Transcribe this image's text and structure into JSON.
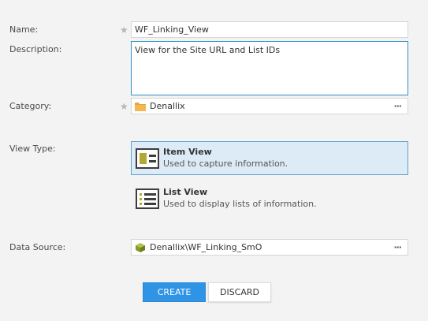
{
  "form": {
    "name_label": "Name:",
    "name_value": "WF_Linking_View",
    "description_label": "Description:",
    "description_value": "View for the Site URL and List IDs",
    "category_label": "Category:",
    "category_value": "Denallix",
    "view_type_label": "View Type:",
    "view_types": [
      {
        "title": "Item View",
        "description": "Used to capture information.",
        "selected": true
      },
      {
        "title": "List View",
        "description": "Used to display lists of information.",
        "selected": false
      }
    ],
    "data_source_label": "Data Source:",
    "data_source_value": "Denallix\\WF_Linking_SmO",
    "required_marker": "★",
    "ellipsis": "···"
  },
  "buttons": {
    "create": "CREATE",
    "discard": "DISCARD"
  },
  "colors": {
    "background": "#f3f3f3",
    "primary": "#2f93e6",
    "selected_bg": "#dcebf6",
    "selected_border": "#5fa2d0",
    "folder": "#e8a33a",
    "smartobject": "#8a9a2e"
  }
}
